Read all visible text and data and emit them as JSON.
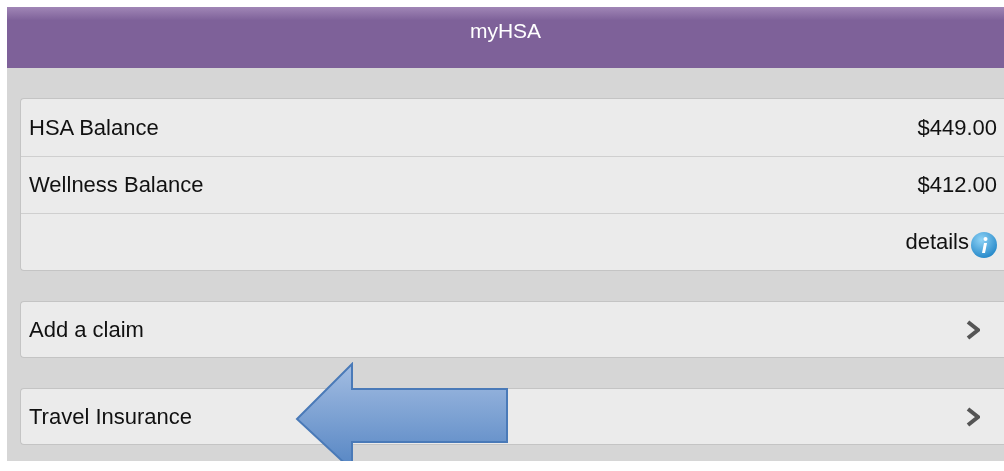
{
  "header": {
    "title": "myHSA"
  },
  "balances": {
    "rows": [
      {
        "label": "HSA Balance",
        "value": "$449.00"
      },
      {
        "label": "Wellness Balance",
        "value": "$412.00"
      }
    ],
    "details_link": "details"
  },
  "menu": [
    {
      "label": "Add a claim"
    },
    {
      "label": "Travel Insurance"
    }
  ]
}
